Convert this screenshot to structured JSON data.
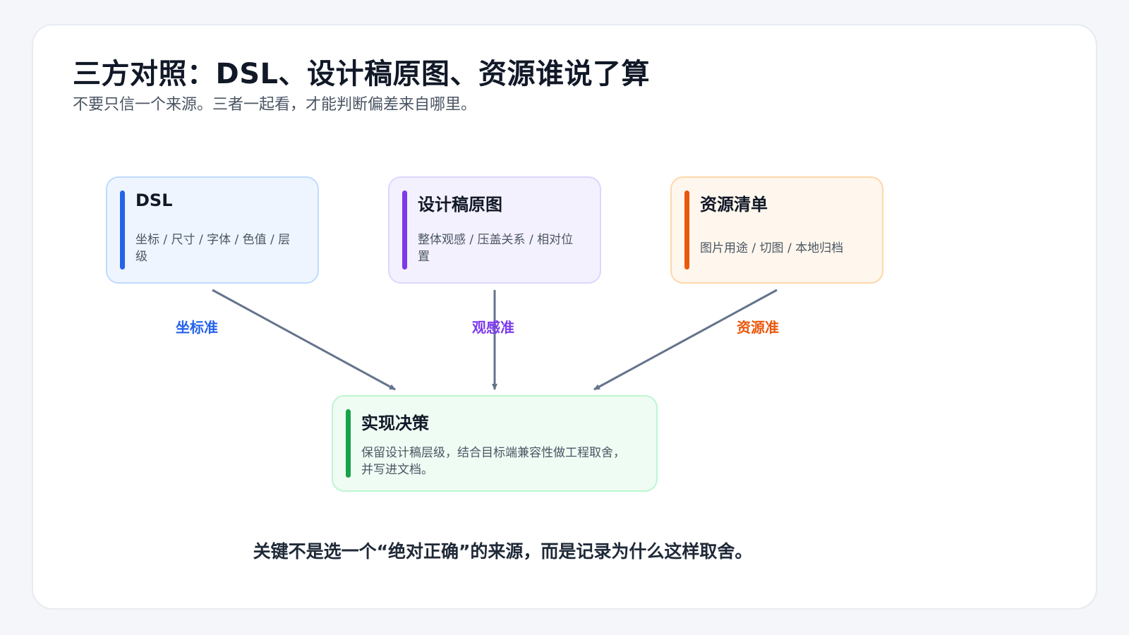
{
  "title": "三方对照：DSL、设计稿原图、资源谁说了算",
  "subtitle": "不要只信一个来源。三者一起看，才能判断偏差来自哪里。",
  "sources": [
    {
      "id": "dsl",
      "title": "DSL",
      "description": "坐标 / 尺寸 / 字体 / 色值 / 层级",
      "accent": "#2563eb"
    },
    {
      "id": "design",
      "title": "设计稿原图",
      "description": "整体观感 / 压盖关系 / 相对位置",
      "accent": "#7c3aed"
    },
    {
      "id": "assets",
      "title": "资源清单",
      "description": "图片用途 / 切图 / 本地归档",
      "accent": "#ea580c"
    }
  ],
  "decision": {
    "title": "实现决策",
    "description": "保留设计稿层级，结合目标端兼容性做工程取舍，并写进文档。",
    "accent": "#16a34a"
  },
  "edges": [
    {
      "from": "dsl",
      "to": "decision",
      "label": "坐标准",
      "color": "#2563eb"
    },
    {
      "from": "design",
      "to": "decision",
      "label": "观感准",
      "color": "#7c3aed"
    },
    {
      "from": "assets",
      "to": "decision",
      "label": "资源准",
      "color": "#ea580c"
    }
  ],
  "arrow_color": "#64748b",
  "footer": "关键不是选一个“绝对正确”的来源，而是记录为什么这样取舍。"
}
